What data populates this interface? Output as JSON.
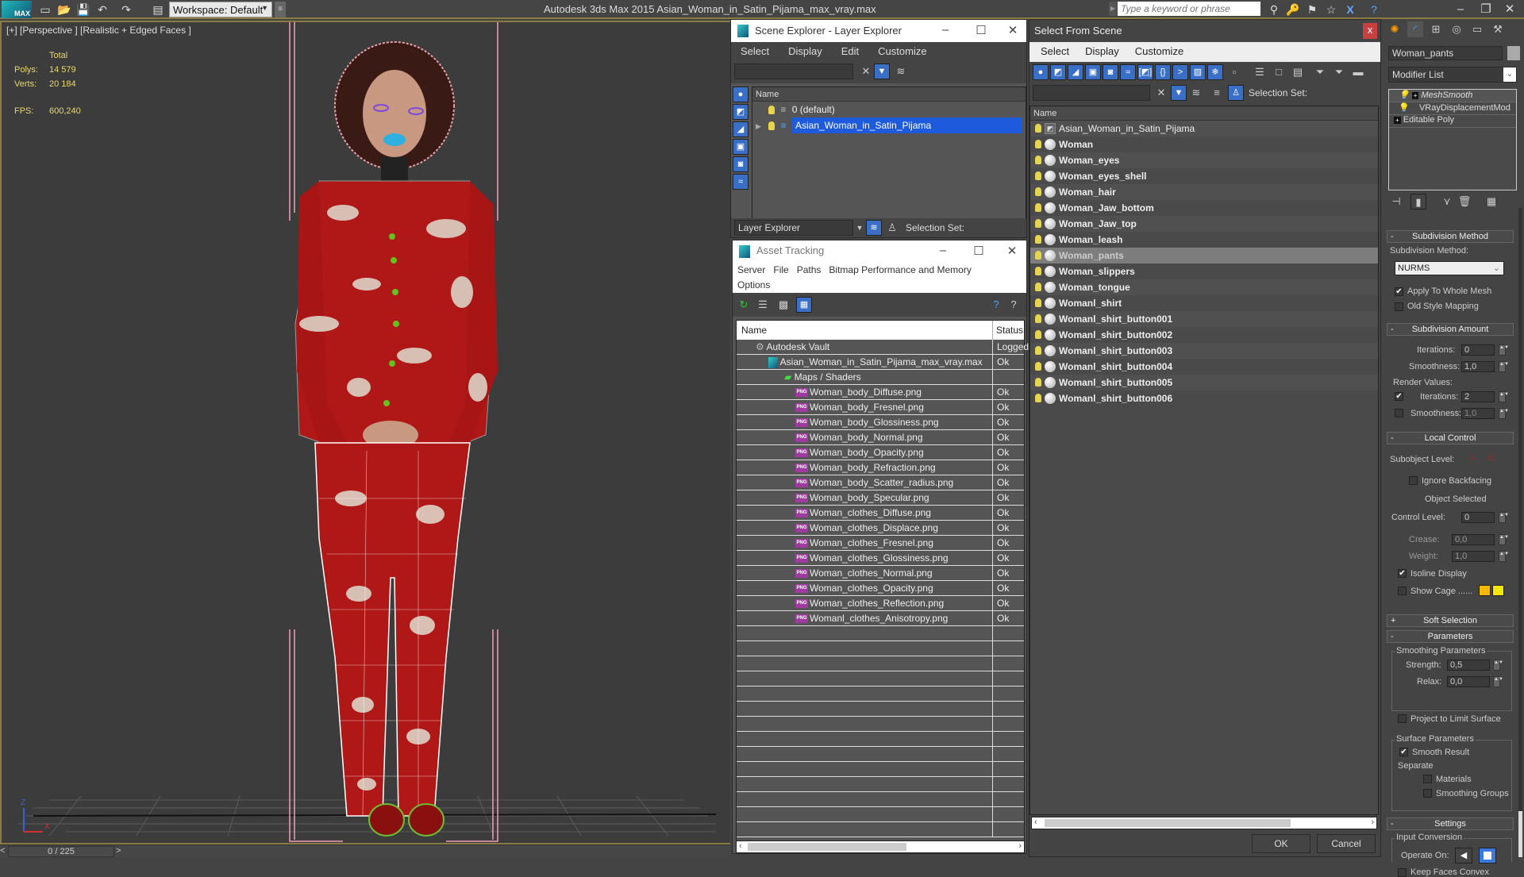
{
  "titlebar": {
    "logo": "MAX",
    "workspace": "Workspace: Default",
    "app_title": "Autodesk 3ds Max  2015    Asian_Woman_in_Satin_Pijama_max_vray.max",
    "search_placeholder": "Type a keyword or phrase"
  },
  "viewport": {
    "label": "[+] [Perspective ] [Realistic + Edged Faces ]",
    "stats": {
      "total_label": "Total",
      "polys_label": "Polys:",
      "polys": "14 579",
      "verts_label": "Verts:",
      "verts": "20 184",
      "fps_label": "FPS:",
      "fps": "600,240"
    },
    "axis": {
      "z": "Z",
      "x": "X"
    }
  },
  "timeline": {
    "frame": "0 / 225",
    "prev": "<",
    "next": ">"
  },
  "scene_explorer": {
    "title": "Scene Explorer - Layer Explorer",
    "menu": [
      "Select",
      "Display",
      "Edit",
      "Customize"
    ],
    "column": "Name",
    "rows": [
      {
        "label": "0 (default)",
        "selected": false
      },
      {
        "label": "Asian_Woman_in_Satin_Pijama",
        "selected": true
      }
    ],
    "explorer_type": "Layer Explorer",
    "selection_set_label": "Selection Set:"
  },
  "asset_tracking": {
    "title": "Asset Tracking",
    "menu": [
      "Server",
      "File",
      "Paths",
      "Bitmap Performance and Memory",
      "Options"
    ],
    "columns": {
      "name": "Name",
      "status": "Status"
    },
    "vault": {
      "name": "Autodesk Vault",
      "status": "Logged"
    },
    "file": {
      "name": "Asian_Woman_in_Satin_Pijama_max_vray.max",
      "status": "Ok"
    },
    "maps_folder": "Maps / Shaders",
    "maps": [
      {
        "name": "Woman_body_Diffuse.png",
        "status": "Ok"
      },
      {
        "name": "Woman_body_Fresnel.png",
        "status": "Ok"
      },
      {
        "name": "Woman_body_Glossiness.png",
        "status": "Ok"
      },
      {
        "name": "Woman_body_Normal.png",
        "status": "Ok"
      },
      {
        "name": "Woman_body_Opacity.png",
        "status": "Ok"
      },
      {
        "name": "Woman_body_Refraction.png",
        "status": "Ok"
      },
      {
        "name": "Woman_body_Scatter_radius.png",
        "status": "Ok"
      },
      {
        "name": "Woman_body_Specular.png",
        "status": "Ok"
      },
      {
        "name": "Woman_clothes_Diffuse.png",
        "status": "Ok"
      },
      {
        "name": "Woman_clothes_Displace.png",
        "status": "Ok"
      },
      {
        "name": "Woman_clothes_Fresnel.png",
        "status": "Ok"
      },
      {
        "name": "Woman_clothes_Glossiness.png",
        "status": "Ok"
      },
      {
        "name": "Woman_clothes_Normal.png",
        "status": "Ok"
      },
      {
        "name": "Woman_clothes_Opacity.png",
        "status": "Ok"
      },
      {
        "name": "Woman_clothes_Reflection.png",
        "status": "Ok"
      },
      {
        "name": "Womanl_clothes_Anisotropy.png",
        "status": "Ok"
      }
    ]
  },
  "select_from_scene": {
    "title": "Select From Scene",
    "close": "x",
    "menu": [
      "Select",
      "Display",
      "Customize"
    ],
    "selection_set_label": "Selection Set:",
    "column": "Name",
    "objects": [
      {
        "name": "Asian_Woman_in_Satin_Pijama",
        "type": "group",
        "highlighted": false
      },
      {
        "name": "Woman",
        "type": "geometry",
        "highlighted": false
      },
      {
        "name": "Woman_eyes",
        "type": "geometry",
        "highlighted": false
      },
      {
        "name": "Woman_eyes_shell",
        "type": "geometry",
        "highlighted": false
      },
      {
        "name": "Woman_hair",
        "type": "geometry",
        "highlighted": false
      },
      {
        "name": "Woman_Jaw_bottom",
        "type": "geometry",
        "highlighted": false
      },
      {
        "name": "Woman_Jaw_top",
        "type": "geometry",
        "highlighted": false
      },
      {
        "name": "Woman_leash",
        "type": "geometry",
        "highlighted": false
      },
      {
        "name": "Woman_pants",
        "type": "geometry",
        "highlighted": true
      },
      {
        "name": "Woman_slippers",
        "type": "geometry",
        "highlighted": false
      },
      {
        "name": "Woman_tongue",
        "type": "geometry",
        "highlighted": false
      },
      {
        "name": "Womanl_shirt",
        "type": "geometry",
        "highlighted": false
      },
      {
        "name": "Womanl_shirt_button001",
        "type": "geometry",
        "highlighted": false
      },
      {
        "name": "Womanl_shirt_button002",
        "type": "geometry",
        "highlighted": false
      },
      {
        "name": "Womanl_shirt_button003",
        "type": "geometry",
        "highlighted": false
      },
      {
        "name": "Womanl_shirt_button004",
        "type": "geometry",
        "highlighted": false
      },
      {
        "name": "Womanl_shirt_button005",
        "type": "geometry",
        "highlighted": false
      },
      {
        "name": "Womanl_shirt_button006",
        "type": "geometry",
        "highlighted": false
      }
    ],
    "ok": "OK",
    "cancel": "Cancel"
  },
  "command_panel": {
    "object_name": "Woman_pants",
    "modifier_list": "Modifier List",
    "stack": [
      "MeshSmooth",
      "VRayDisplacementMod",
      "Editable Poly"
    ],
    "subdivision_method": {
      "title": "Subdivision Method",
      "label": "Subdivision Method:",
      "value": "NURMS",
      "apply_whole_mesh": "Apply To Whole Mesh",
      "apply_whole_mesh_checked": true,
      "old_style_mapping": "Old Style Mapping",
      "old_style_mapping_checked": false
    },
    "subdivision_amount": {
      "title": "Subdivision Amount",
      "iterations_label": "Iterations:",
      "iterations": "0",
      "smoothness_label": "Smoothness:",
      "smoothness": "1,0",
      "render_values_label": "Render Values:",
      "render_iterations_label": "Iterations:",
      "render_iterations": "2",
      "render_iterations_checked": true,
      "render_smoothness_label": "Smoothness:",
      "render_smoothness": "1,0",
      "render_smoothness_checked": false
    },
    "local_control": {
      "title": "Local Control",
      "subobject_label": "Subobject Level:",
      "ignore_backfacing": "Ignore Backfacing",
      "status": "Object Selected",
      "control_level_label": "Control Level:",
      "control_level": "0",
      "crease_label": "Crease:",
      "crease": "0,0",
      "weight_label": "Weight:",
      "weight": "1,0",
      "isoline_display": "Isoline Display",
      "isoline_checked": true,
      "show_cage": "Show Cage ......",
      "cage_colors": [
        "#f5b800",
        "#f5e800"
      ]
    },
    "soft_selection": {
      "title": "Soft Selection"
    },
    "parameters": {
      "title": "Parameters",
      "smoothing_group": "Smoothing Parameters",
      "strength_label": "Strength:",
      "strength": "0,5",
      "relax_label": "Relax:",
      "relax": "0,0",
      "project_limit": "Project to Limit Surface",
      "surface_group": "Surface Parameters",
      "smooth_result": "Smooth Result",
      "separate_label": "Separate",
      "materials": "Materials",
      "smoothing_groups": "Smoothing Groups"
    },
    "settings": {
      "title": "Settings",
      "input_conversion": "Input Conversion",
      "operate_on_label": "Operate On:",
      "keep_faces_convex": "Keep Faces Convex"
    }
  }
}
